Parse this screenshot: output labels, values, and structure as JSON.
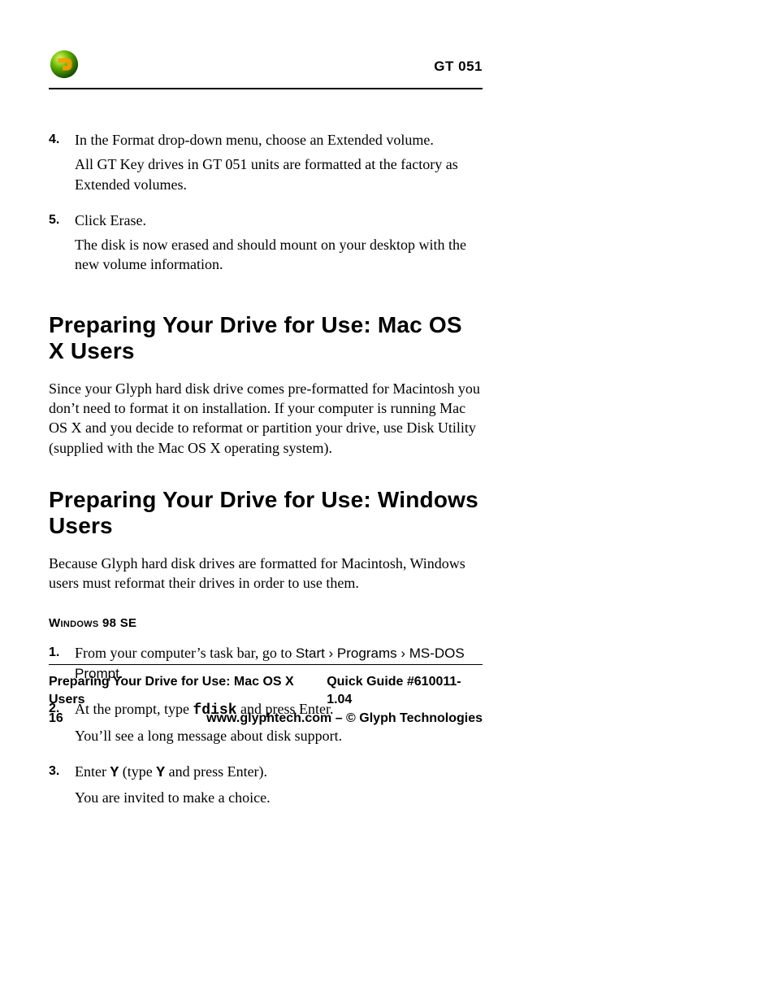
{
  "header": {
    "doc_id": "GT 051"
  },
  "steps_top": [
    {
      "num": "4.",
      "lines": [
        "In the Format drop-down menu, choose an Extended volume.",
        "All GT Key drives in GT 051 units are formatted at the factory as Extended volumes."
      ]
    },
    {
      "num": "5.",
      "lines": [
        "Click Erase.",
        "The disk is now erased and should mount on your desktop with the new volume information."
      ]
    }
  ],
  "section_mac": {
    "title": "Preparing Your Drive for Use: Mac OS X Users",
    "para": "Since your Glyph hard disk drive comes pre-formatted for Macintosh you don’t need to format it on installation. If your computer is running Mac OS X and you decide to reformat or partition your drive, use Disk Utility (supplied with the Mac OS X operating system)."
  },
  "section_win": {
    "title": "Preparing Your Drive for Use: Windows Users",
    "para": "Because Glyph hard disk drives are formatted for Macintosh, Windows users must reformat their drives in order to use them.",
    "subhead_pre": "W",
    "subhead_rest": "indows 98 SE",
    "steps": [
      {
        "num": "1.",
        "pre": "From your computer’s task bar, go to ",
        "ui": "Start › Programs › MS-DOS Prompt",
        "post": "."
      },
      {
        "num": "2.",
        "pre": "At the prompt, type ",
        "cmd": "fdisk",
        "post": " and press Enter.",
        "after": "You’ll see a long message about disk support."
      },
      {
        "num": "3.",
        "pre": "Enter ",
        "cmd": "Y",
        "mid": "  (type ",
        "cmd2": "Y",
        "post": " and press Enter).",
        "after": "You are invited to make a choice."
      }
    ]
  },
  "footer": {
    "left1": "Preparing Your Drive for Use: Mac OS X Users",
    "right1": "Quick Guide  #610011-1.04",
    "left2": "16",
    "right2": "www.glyphtech.com – © Glyph Technologies"
  }
}
